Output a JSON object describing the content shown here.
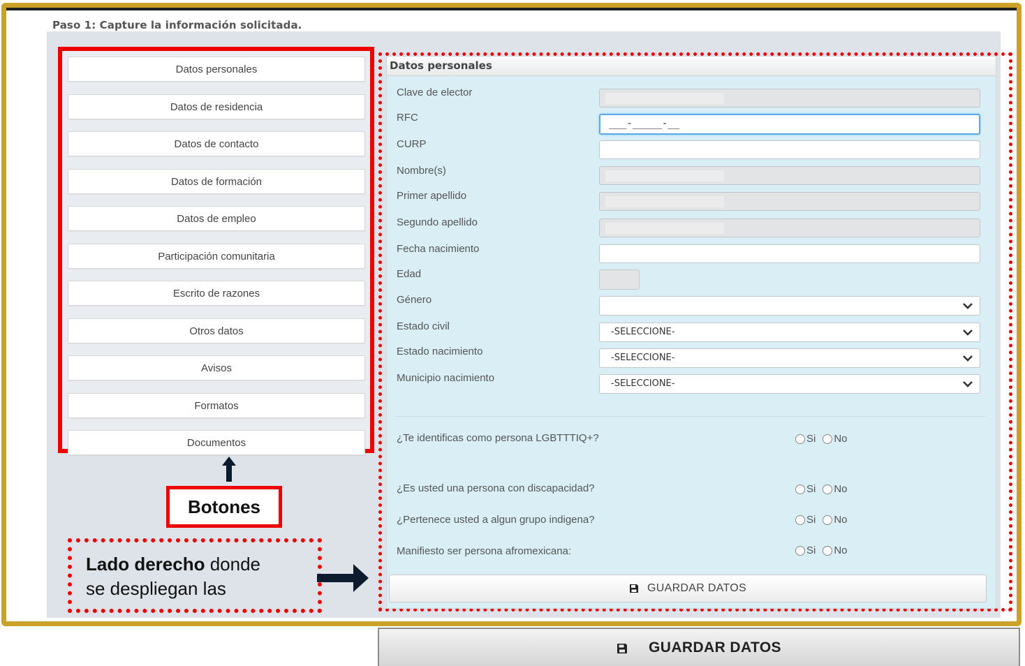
{
  "step_title": "Paso 1: Capture la información solicitada.",
  "nav": [
    "Datos personales",
    "Datos de residencia",
    "Datos de contacto",
    "Datos de formación",
    "Datos de empleo",
    "Participación comunitaria",
    "Escrito de razones",
    "Otros datos",
    "Avisos",
    "Formatos",
    "Documentos"
  ],
  "annotations": {
    "buttons_label": "Botones",
    "note_bold": "Lado derecho",
    "note_rest_1": " donde",
    "note_line_2": "se despliegan las"
  },
  "panel": {
    "title": "Datos personales",
    "fields": {
      "clave_elector": "Clave de elector",
      "rfc": "RFC",
      "rfc_mask": "___-_____-__",
      "curp": "CURP",
      "nombre": "Nombre(s)",
      "primer_apellido": "Primer apellido",
      "segundo_apellido": "Segundo apellido",
      "fecha_nacimiento": "Fecha nacimiento",
      "edad": "Edad",
      "genero": "Género",
      "estado_civil": "Estado civil",
      "estado_nacimiento": "Estado nacimiento",
      "municipio_nacimiento": "Municipio nacimiento"
    },
    "select_placeholder": "-SELECCIONE-",
    "questions": {
      "lgbt": "¿Te identificas como persona LGBTTTIQ+?",
      "discapacidad": "¿Es usted una persona con discapacidad?",
      "indigena": "¿Pertenece usted a algun grupo indigena?",
      "afro": "Manifiesto ser persona afromexicana:"
    },
    "yes": "Si",
    "no": "No",
    "save_button": "GUARDAR DATOS"
  },
  "bottom_save_button": "GUARDAR DATOS",
  "colors": {
    "frame": "#c9a227",
    "highlight_red": "#ee0000",
    "panel_bg": "#d9eff5",
    "focus_blue": "#5aa9e6"
  },
  "icons": {
    "save": "floppy-disk-icon",
    "chevron": "chevron-down-icon",
    "arrow_up": "arrow-up-icon",
    "arrow_right": "arrow-right-icon"
  }
}
